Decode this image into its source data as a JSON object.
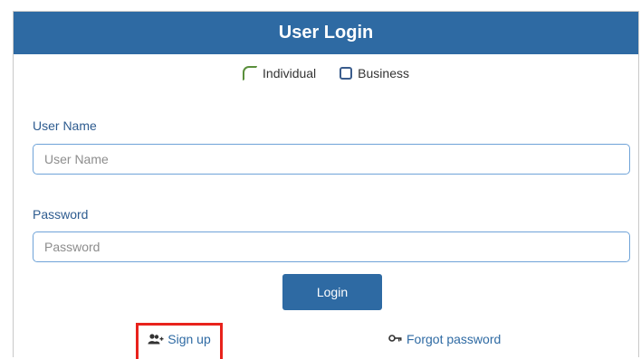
{
  "header": {
    "title": "User Login"
  },
  "login_type": {
    "options": [
      {
        "label": "Individual",
        "icon": "radio-icon",
        "selected": true
      },
      {
        "label": "Business",
        "icon": "checkbox-icon",
        "selected": false
      }
    ]
  },
  "username": {
    "label": "User Name",
    "placeholder": "User Name",
    "value": ""
  },
  "password": {
    "label": "Password",
    "placeholder": "Password",
    "value": ""
  },
  "login_button": {
    "label": "Login"
  },
  "links": {
    "signup": {
      "label": "Sign up",
      "icon": "add-user-icon"
    },
    "forgot": {
      "label": "Forgot password",
      "icon": "key-icon"
    }
  },
  "colors": {
    "header_bg": "#2e6aa3",
    "highlight_border": "#e8221c",
    "link": "#2e6aa3"
  }
}
